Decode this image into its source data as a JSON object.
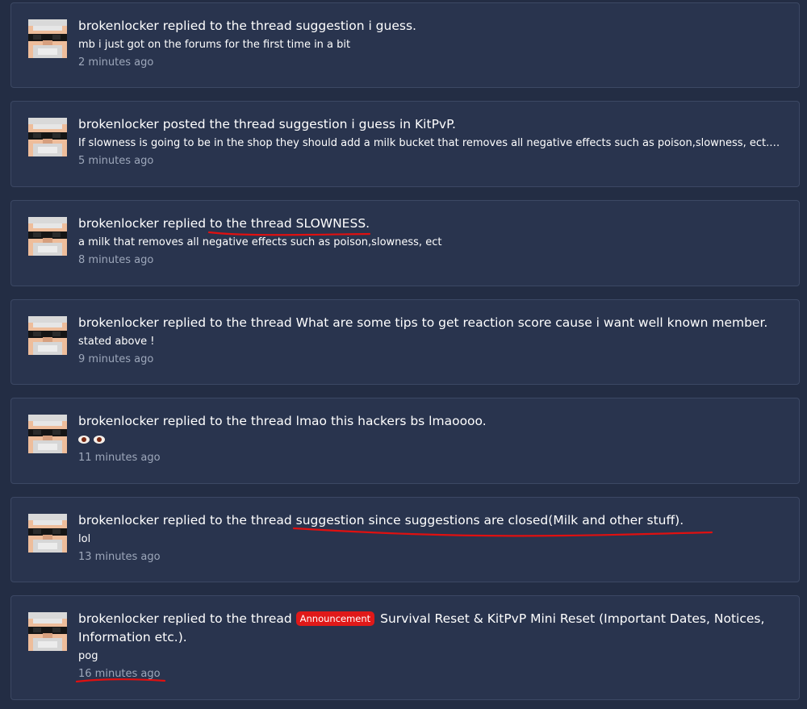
{
  "feed": {
    "items": [
      {
        "user": "brokenlocker",
        "action": "replied to the thread",
        "thread": "suggestion i guess.",
        "snippet": "mb i just got on the forums for the first time in a bit",
        "time": "2 minutes ago"
      },
      {
        "user": "brokenlocker",
        "action": "posted the thread",
        "thread": "suggestion i guess",
        "in_word": "in",
        "forum": "KitPvP.",
        "snippet": "If slowness is going to be in the shop they should add a milk bucket that removes all negative effects such as poison,slowness, ect. (Or...",
        "time": "5 minutes ago"
      },
      {
        "user": "brokenlocker",
        "action": "replied to the thread",
        "thread": "SLOWNESS.",
        "snippet": "a milk that removes all negative effects such as poison,slowness, ect",
        "time": "8 minutes ago"
      },
      {
        "user": "brokenlocker",
        "action": "replied to the thread",
        "thread": "What are some tips to get reaction score cause i want well known member.",
        "snippet": "stated above !",
        "time": "9 minutes ago"
      },
      {
        "user": "brokenlocker",
        "action": "replied to the thread",
        "thread": "lmao this hackers bs lmaoooo.",
        "snippet_icons": [
          "eye-emoji",
          "eye-emoji"
        ],
        "time": "11 minutes ago"
      },
      {
        "user": "brokenlocker",
        "action": "replied to the thread",
        "thread": "suggestion since suggestions are closed(Milk and other stuff).",
        "snippet": "lol",
        "time": "13 minutes ago"
      },
      {
        "user": "brokenlocker",
        "action": "replied to the thread",
        "prefix": "Announcement",
        "thread": "Survival Reset & KitPvP Mini Reset (Important Dates, Notices, Information etc.).",
        "snippet": "pog",
        "time": "16 minutes ago"
      }
    ]
  },
  "colors": {
    "background": "#232d44",
    "card": "#29344e",
    "border": "#3c4864",
    "time_text": "#9da7ba",
    "prefix_badge": "#e01919",
    "annotation_red": "#e01010"
  }
}
